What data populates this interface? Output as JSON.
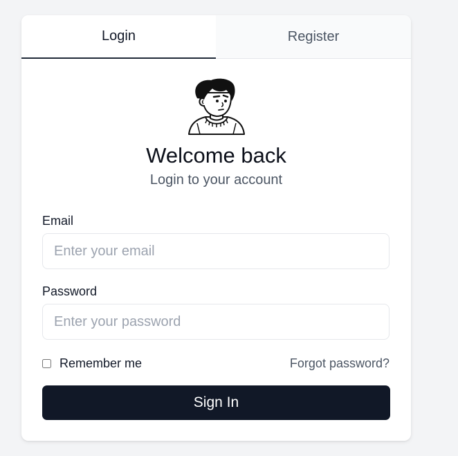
{
  "tabs": {
    "login": "Login",
    "register": "Register"
  },
  "header": {
    "avatar_icon": "cartoon-avatar-icon",
    "title": "Welcome back",
    "subtitle": "Login to your account"
  },
  "form": {
    "email_label": "Email",
    "email_placeholder": "Enter your email",
    "email_value": "",
    "password_label": "Password",
    "password_placeholder": "Enter your password",
    "password_value": "",
    "remember_label": "Remember me",
    "remember_checked": false,
    "forgot_link": "Forgot password?",
    "submit_label": "Sign In"
  },
  "colors": {
    "primary": "#111827",
    "background": "#f3f4f6",
    "card": "#ffffff",
    "muted_text": "#4b5563",
    "placeholder": "#9ca3af",
    "border": "#e5e7eb"
  }
}
